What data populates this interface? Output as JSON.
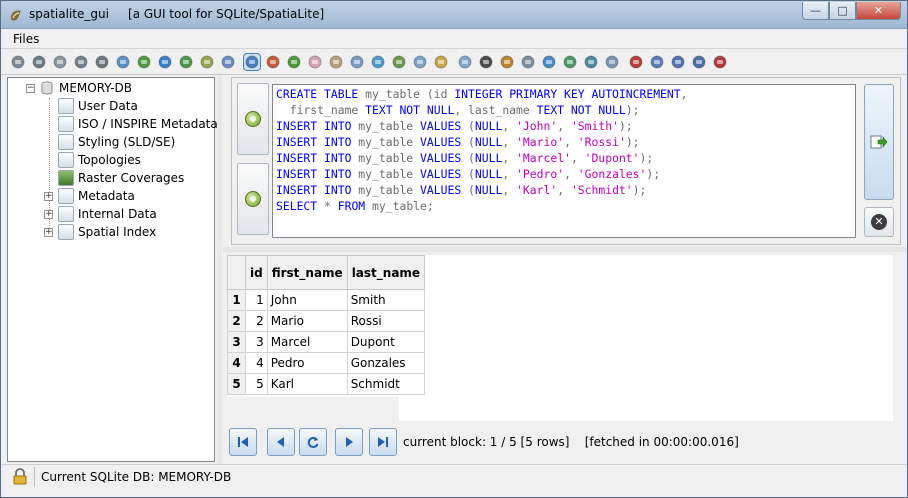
{
  "window": {
    "app_name": "spatialite_gui",
    "title": "[a GUI tool for SQLite/SpatiaLite]",
    "controls": {
      "minimize": "—",
      "maximize": "□",
      "close": "✕"
    }
  },
  "menu": {
    "items": [
      "Files"
    ]
  },
  "toolbar": {
    "icons": [
      "connect-icon",
      "create-db-icon",
      "disconnect-icon",
      "memory-db-icon",
      "save-memory-icon",
      "clone-icon",
      "vacuum-icon",
      "sql-script-icon",
      "load-shp-icon",
      "load-txt-icon",
      "virtual-shp-icon",
      "query-view-composer-icon",
      "spatial-index-icon",
      "network-icon",
      "exif-icon",
      "load-xml-icon",
      "srid-icon",
      "attach-icon",
      "sql-log-icon",
      "dbf-icon",
      "charset-icon",
      "wfs-icon",
      "dxf-icon",
      "load-gpkg-icon",
      "topology-icon",
      "raster-icon",
      "vector-icon",
      "check-geometry-icon",
      "sanitize-icon",
      "svg-icon",
      "map-icon",
      "help-icon",
      "about-icon",
      "exit-icon"
    ],
    "active_index": 11
  },
  "tree": {
    "root": "MEMORY-DB",
    "items": [
      {
        "label": "User Data",
        "expandable": false
      },
      {
        "label": "ISO / INSPIRE Metadata",
        "expandable": false
      },
      {
        "label": "Styling (SLD/SE)",
        "expandable": false
      },
      {
        "label": "Topologies",
        "expandable": false
      },
      {
        "label": "Raster Coverages",
        "expandable": false
      },
      {
        "label": "Metadata",
        "expandable": true
      },
      {
        "label": "Internal Data",
        "expandable": true
      },
      {
        "label": "Spatial Index",
        "expandable": true
      }
    ]
  },
  "sql": {
    "lines": [
      [
        [
          "kw",
          "CREATE TABLE "
        ],
        [
          "id",
          "my_table "
        ],
        [
          "id",
          "("
        ],
        [
          "id",
          "id "
        ],
        [
          "kw",
          "INTEGER PRIMARY KEY AUTOINCREMENT"
        ],
        [
          "id",
          ","
        ]
      ],
      [
        [
          "id",
          "  first_name "
        ],
        [
          "kw",
          "TEXT NOT NULL"
        ],
        [
          "id",
          ", last_name "
        ],
        [
          "kw",
          "TEXT NOT NULL"
        ],
        [
          "id",
          ");"
        ]
      ],
      [
        [
          "kw",
          "INSERT INTO "
        ],
        [
          "id",
          "my_table "
        ],
        [
          "kw",
          "VALUES "
        ],
        [
          "id",
          "("
        ],
        [
          "kw",
          "NULL"
        ],
        [
          "id",
          ", "
        ],
        [
          "str",
          "'John'"
        ],
        [
          "id",
          ", "
        ],
        [
          "str",
          "'Smith'"
        ],
        [
          "id",
          ");"
        ]
      ],
      [
        [
          "kw",
          "INSERT INTO "
        ],
        [
          "id",
          "my_table "
        ],
        [
          "kw",
          "VALUES "
        ],
        [
          "id",
          "("
        ],
        [
          "kw",
          "NULL"
        ],
        [
          "id",
          ", "
        ],
        [
          "str",
          "'Mario'"
        ],
        [
          "id",
          ", "
        ],
        [
          "str",
          "'Rossi'"
        ],
        [
          "id",
          ");"
        ]
      ],
      [
        [
          "kw",
          "INSERT INTO "
        ],
        [
          "id",
          "my_table "
        ],
        [
          "kw",
          "VALUES "
        ],
        [
          "id",
          "("
        ],
        [
          "kw",
          "NULL"
        ],
        [
          "id",
          ", "
        ],
        [
          "str",
          "'Marcel'"
        ],
        [
          "id",
          ", "
        ],
        [
          "str",
          "'Dupont'"
        ],
        [
          "id",
          ");"
        ]
      ],
      [
        [
          "kw",
          "INSERT INTO "
        ],
        [
          "id",
          "my_table "
        ],
        [
          "kw",
          "VALUES "
        ],
        [
          "id",
          "("
        ],
        [
          "kw",
          "NULL"
        ],
        [
          "id",
          ", "
        ],
        [
          "str",
          "'Pedro'"
        ],
        [
          "id",
          ", "
        ],
        [
          "str",
          "'Gonzales'"
        ],
        [
          "id",
          ");"
        ]
      ],
      [
        [
          "kw",
          "INSERT INTO "
        ],
        [
          "id",
          "my_table "
        ],
        [
          "kw",
          "VALUES "
        ],
        [
          "id",
          "("
        ],
        [
          "kw",
          "NULL"
        ],
        [
          "id",
          ", "
        ],
        [
          "str",
          "'Karl'"
        ],
        [
          "id",
          ", "
        ],
        [
          "str",
          "'Schmidt'"
        ],
        [
          "id",
          ");"
        ]
      ],
      [
        [
          "kw",
          "SELECT "
        ],
        [
          "id",
          "* "
        ],
        [
          "kw",
          "FROM "
        ],
        [
          "id",
          "my_table;"
        ]
      ]
    ]
  },
  "results": {
    "columns": [
      "id",
      "first_name",
      "last_name"
    ],
    "rows": [
      {
        "n": "1",
        "id": "1",
        "first_name": "John",
        "last_name": "Smith"
      },
      {
        "n": "2",
        "id": "2",
        "first_name": "Mario",
        "last_name": "Rossi"
      },
      {
        "n": "3",
        "id": "3",
        "first_name": "Marcel",
        "last_name": "Dupont"
      },
      {
        "n": "4",
        "id": "4",
        "first_name": "Pedro",
        "last_name": "Gonzales"
      },
      {
        "n": "5",
        "id": "5",
        "first_name": "Karl",
        "last_name": "Schmidt"
      }
    ]
  },
  "navigation": {
    "buttons": [
      "first-block-icon",
      "previous-block-icon",
      "refresh-icon",
      "next-block-icon",
      "last-block-icon"
    ],
    "status": "current block: 1 / 5 [5 rows]    [fetched in 00:00:00.016]"
  },
  "statusbar": {
    "text": "Current SQLite DB: MEMORY-DB"
  },
  "colors": {
    "keyword": "#0000ff",
    "string": "#c000c0",
    "identifier": "#6c6c6c"
  }
}
